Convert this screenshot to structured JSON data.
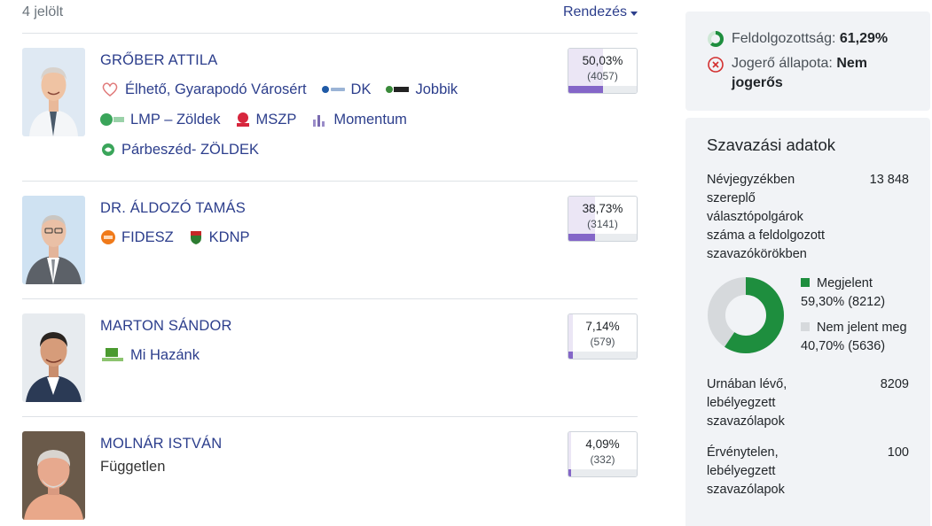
{
  "header": {
    "count_text": "4 jelölt",
    "sort_label": "Rendezés"
  },
  "candidates": [
    {
      "name": "GRŐBER ATTILA",
      "percent": "50,03%",
      "votes": "(4057)",
      "share": 0.5003,
      "parties": [
        {
          "name": "Élhető, Gyarapodó Városért",
          "icon": "elheto-logo-icon",
          "color": "#e07a7a"
        },
        {
          "name": "DK",
          "icon": "dk-logo-icon",
          "color": "#1f5aa6"
        },
        {
          "name": "Jobbik",
          "icon": "jobbik-logo-icon",
          "color": "#222222"
        },
        {
          "name": "LMP – Zöldek",
          "icon": "lmp-logo-icon",
          "color": "#3aa55a"
        },
        {
          "name": "MSZP",
          "icon": "mszp-logo-icon",
          "color": "#d7263d"
        },
        {
          "name": "Momentum",
          "icon": "momentum-logo-icon",
          "color": "#7a6bb0"
        },
        {
          "name": "Párbeszéd- ZÖLDEK",
          "icon": "parbeszed-logo-icon",
          "color": "#3aa55a"
        }
      ]
    },
    {
      "name": "DR. ÁLDOZÓ TAMÁS",
      "percent": "38,73%",
      "votes": "(3141)",
      "share": 0.3873,
      "parties": [
        {
          "name": "FIDESZ",
          "icon": "fidesz-logo-icon",
          "color": "#f07a1a"
        },
        {
          "name": "KDNP",
          "icon": "kdnp-logo-icon",
          "color": "#2e7d32"
        }
      ]
    },
    {
      "name": "MARTON SÁNDOR",
      "percent": "7,14%",
      "votes": "(579)",
      "share": 0.0714,
      "parties": [
        {
          "name": "Mi Hazánk",
          "icon": "mi-hazank-logo-icon",
          "color": "#4a9a2f"
        }
      ]
    },
    {
      "name": "MOLNÁR ISTVÁN",
      "percent": "4,09%",
      "votes": "(332)",
      "share": 0.0409,
      "independent_label": "Független",
      "parties": []
    }
  ],
  "status": {
    "processing_label": "Feldolgozottság:",
    "processing_value": "61,29%",
    "processing_fraction": 0.6129,
    "legal_label": "Jogerő állapota:",
    "legal_value": "Nem jogerős"
  },
  "voting": {
    "title": "Szavazási adatok",
    "registered_label": "Névjegyzékben szereplő választópolgárok száma a feldolgozott szavazókörökben",
    "registered_value": "13 848",
    "appeared_label": "Megjelent",
    "appeared_value": "59,30% (8212)",
    "appeared_fraction": 0.593,
    "not_appeared_label": "Nem jelent meg",
    "not_appeared_value": "40,70% (5636)",
    "ballots_label": "Urnában lévő, lebélyegzett szavazólapok",
    "ballots_value": "8209",
    "invalid_label": "Érvénytelen, lebélyegzett szavazólapok",
    "invalid_value": "100",
    "colors": {
      "appeared": "#1e8e3e",
      "not_appeared": "#d6d9dc",
      "accent": "#8466c8",
      "link": "#2c3e8c"
    }
  }
}
